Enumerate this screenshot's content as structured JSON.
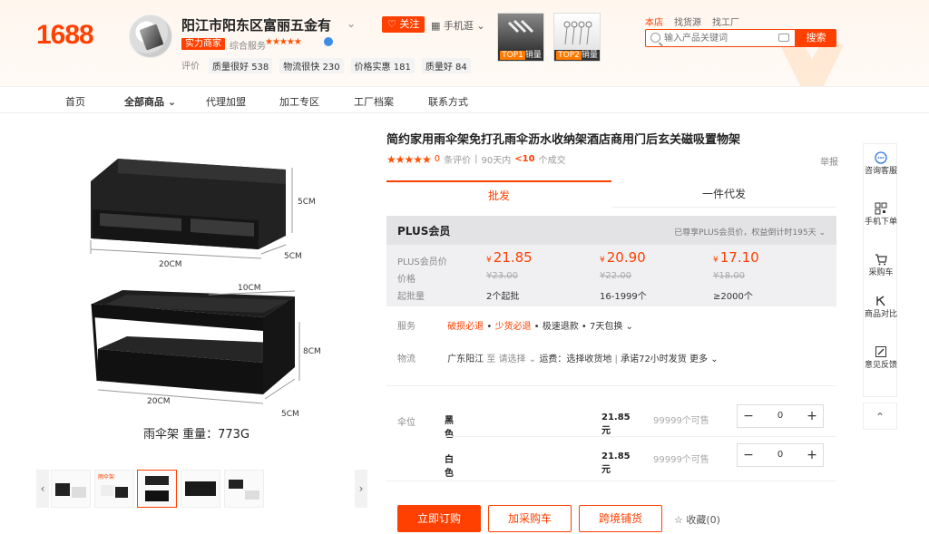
{
  "header": {
    "logo": "1688",
    "shop_name": "阳江市阳东区富丽五金有",
    "follow_label": "关注",
    "mobile_label": "手机逛",
    "strength_badge": "实力商家",
    "overall_rating_label": "综合服务",
    "overall_stars": "★★★★★",
    "evaluations": {
      "label": "评价",
      "items": [
        {
          "label": "质量很好",
          "count": "538"
        },
        {
          "label": "物流很快",
          "count": "230"
        },
        {
          "label": "价格实惠",
          "count": "181"
        },
        {
          "label": "质量好",
          "count": "84"
        }
      ]
    },
    "top_products": [
      {
        "rank": "TOP1",
        "label": "销量"
      },
      {
        "rank": "TOP2",
        "label": "销量"
      }
    ],
    "site_tabs": [
      "本店",
      "找货源",
      "找工厂"
    ],
    "search_placeholder": "输入产品关键词",
    "search_button": "搜索"
  },
  "nav": {
    "items": [
      "首页",
      "全部商品",
      "代理加盟",
      "加工专区",
      "工厂档案",
      "联系方式"
    ]
  },
  "gallery": {
    "dim_top_width": "20CM",
    "dim_top_depth": "5CM",
    "dim_top_height": "5CM",
    "dim_bottom_inner": "10CM",
    "dim_bottom_height": "8CM",
    "dim_bottom_width": "20CM",
    "dim_bottom_depth": "5CM",
    "caption": "雨伞架 重量：773G",
    "thumb_count": 5,
    "active_thumb_index": 2,
    "thumb_tag": "雨伞架"
  },
  "product": {
    "title": "简约家用雨伞架免打孔雨伞沥水收纳架酒店商用门后玄关磁吸置物架",
    "stars": "★★★★★",
    "review_count": "0",
    "review_label": "条评价",
    "deal_prefix": "90天内",
    "deal_count": "<10",
    "deal_suffix": "个成交",
    "report_label": "举报"
  },
  "tabs": {
    "wholesale": "批发",
    "dropship": "一件代发"
  },
  "price_panel": {
    "title": "PLUS会员",
    "note": "已尊享PLUS会员价，权益倒计时195天",
    "plus_price_label": "PLUS会员价",
    "price_label": "价格",
    "moq_label": "起批量",
    "currency": "¥",
    "tiers": [
      {
        "plus_price": "21.85",
        "price": "¥23.00",
        "moq": "2个起批"
      },
      {
        "plus_price": "20.90",
        "price": "¥22.00",
        "moq": "16-1999个"
      },
      {
        "plus_price": "17.10",
        "price": "¥18.00",
        "moq": "≥2000个"
      }
    ]
  },
  "services": {
    "label": "服务",
    "items_highlight": [
      "破损必退",
      "少货必退"
    ],
    "items_normal": [
      "极速退款",
      "7天包换"
    ]
  },
  "logistics": {
    "label": "物流",
    "origin": "广东阳江",
    "to": "至",
    "select": "请选择",
    "fee": "运费：选择收货地",
    "promise": "承诺72小时发货",
    "more": "更多"
  },
  "sku": {
    "label": "伞位",
    "items": [
      {
        "name": "黑色",
        "price": "21.85元",
        "stock": "99999个可售",
        "qty": "0"
      },
      {
        "name": "白色",
        "price": "21.85元",
        "stock": "99999个可售",
        "qty": "0"
      }
    ]
  },
  "actions": {
    "buy": "立即订购",
    "cart": "加采购车",
    "cross_border": "跨境铺货",
    "favorite": "收藏(0)"
  },
  "side_tools": [
    {
      "label": "咨询客服",
      "icon": "chat-icon"
    },
    {
      "label": "手机下单",
      "icon": "qrcode-icon"
    },
    {
      "label": "采购车",
      "icon": "cart-icon"
    },
    {
      "label": "商品对比",
      "icon": "compare-icon"
    },
    {
      "label": "意见反馈",
      "icon": "feedback-icon"
    }
  ],
  "colors": {
    "accent": "#ff4000",
    "star": "#ff5000",
    "plus_panel": "#f0f0f2"
  }
}
